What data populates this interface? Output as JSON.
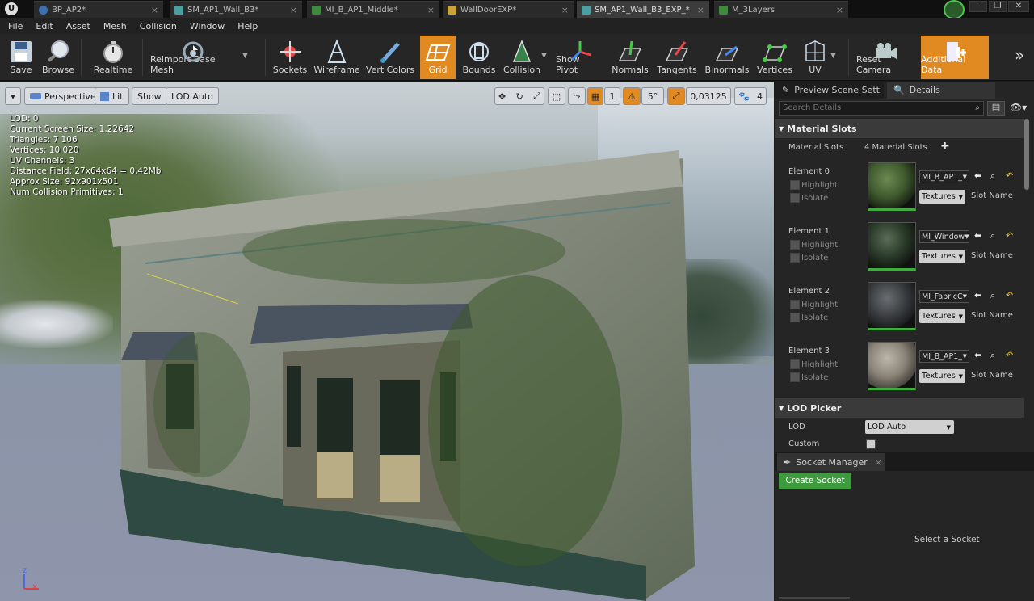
{
  "tabs": [
    {
      "label": "BP_AP2*"
    },
    {
      "label": "SM_AP1_Wall_B3*"
    },
    {
      "label": "MI_B_AP1_Middle*"
    },
    {
      "label": "WallDoorEXP*"
    },
    {
      "label": "SM_AP1_Wall_B3_EXP_*"
    },
    {
      "label": "M_3Layers"
    }
  ],
  "menu": [
    "File",
    "Edit",
    "Asset",
    "Mesh",
    "Collision",
    "Window",
    "Help"
  ],
  "toolbar": {
    "save": "Save",
    "browse": "Browse",
    "realtime": "Realtime",
    "reimport": "Reimport Base Mesh",
    "sockets": "Sockets",
    "wireframe": "Wireframe",
    "vert_colors": "Vert Colors",
    "grid": "Grid",
    "bounds": "Bounds",
    "collision": "Collision",
    "show_pivot": "Show Pivot",
    "normals": "Normals",
    "tangents": "Tangents",
    "binormals": "Binormals",
    "vertices": "Vertices",
    "uv": "UV",
    "reset_camera": "Reset Camera",
    "additional_data": "Additional Data",
    "accent": "#e08a21"
  },
  "viewport": {
    "perspective": "Perspective",
    "lit": "Lit",
    "show": "Show",
    "lod": "LOD Auto",
    "grid_size": "1",
    "angle": "5°",
    "scale": "0,03125",
    "camera_speed": "4",
    "axis_z": "z",
    "axis_x": "x",
    "stats": [
      "LOD:  0",
      "Current Screen Size:  1,22642",
      "Triangles:  7 106",
      "Vertices:  10 020",
      "UV Channels:  3",
      "Distance Field:  27x64x64 = 0,42Mb",
      "Approx Size:  92x901x501",
      "Num Collision Primitives:  1"
    ]
  },
  "panel": {
    "tab_preview": "Preview Scene Sett",
    "tab_details": "Details",
    "search_placeholder": "Search Details",
    "material_slots_header": "Material Slots",
    "material_slots_label": "Material Slots",
    "material_slots_count": "4 Material Slots",
    "highlight": "Highlight",
    "isolate": "Isolate",
    "textures": "Textures",
    "slot_name": "Slot Name",
    "elements": [
      {
        "label": "Element 0",
        "material": "MI_B_AP1_"
      },
      {
        "label": "Element 1",
        "material": "MI_Window"
      },
      {
        "label": "Element 2",
        "material": "MI_FabricC"
      },
      {
        "label": "Element 3",
        "material": "MI_B_AP1_"
      }
    ],
    "lod_picker_header": "LOD Picker",
    "lod_label": "LOD",
    "lod_value": "LOD Auto",
    "custom_label": "Custom",
    "socket_manager": "Socket Manager",
    "create_socket": "Create Socket",
    "select_socket": "Select a Socket"
  }
}
